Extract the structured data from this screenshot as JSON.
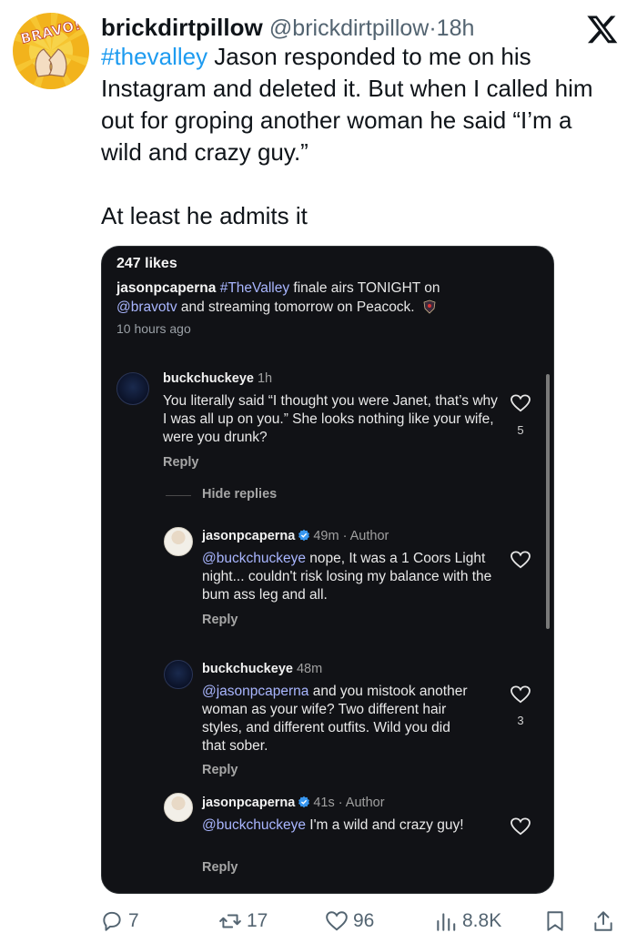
{
  "tweet": {
    "avatar_logo_text": "BRAVO!",
    "display_name": "brickdirtpillow",
    "handle": "@brickdirtpillow",
    "separator": "·",
    "time": "18h",
    "hashtag": "#thevalley",
    "text_1": " Jason responded to me on his Instagram and deleted it. But when I called him out for groping another woman he said “I’m a wild and crazy guy.”",
    "text_2": "At least he admits it"
  },
  "screenshot": {
    "likes": "247 likes",
    "caption_user": "jasonpcaperna",
    "caption_hashtag": "#TheValley",
    "caption_text_1": " finale airs TONIGHT on",
    "caption_mention": "@bravotv",
    "caption_text_2": " and streaming tomorrow on Peacock.",
    "caption_time": "10 hours ago",
    "hide_replies": "Hide replies",
    "comments": [
      {
        "user": "buckchuckeye",
        "meta": " 1h",
        "text": "You literally said “I thought you were Janet, that’s why I was all up on you.” She looks nothing like your wife, were you drunk?",
        "reply": "Reply",
        "likes": "5"
      },
      {
        "user": "jasonpcaperna",
        "meta": "49m · Author",
        "mention": "@buckchuckeye",
        "text": " nope, It was a 1 Coors Light night... couldn't risk losing my balance with the bum ass leg and all.",
        "reply": "Reply",
        "likes": ""
      },
      {
        "user": "buckchuckeye",
        "meta": " 48m",
        "mention": "@jasonpcaperna",
        "text": " and you mistook another woman as your wife? Two different hair styles, and different outfits. Wild you did that sober.",
        "reply": "Reply",
        "likes": "3"
      },
      {
        "user": "jasonpcaperna",
        "meta": "41s · Author",
        "mention": "@buckchuckeye",
        "text": " I'm a wild and crazy guy!",
        "reply": "Reply",
        "likes": ""
      }
    ]
  },
  "actions": {
    "replies": "7",
    "reposts": "17",
    "likes": "96",
    "views": "8.8K"
  },
  "colors": {
    "link_blue": "#1d9bf0",
    "card_bg": "#111216",
    "mention": "#a9b6ff",
    "muted": "#536471"
  },
  "icons": [
    "x-logo-icon",
    "verified-badge-icon",
    "heart-icon",
    "reply-icon",
    "repost-icon",
    "like-icon",
    "views-icon",
    "bookmark-icon",
    "share-icon"
  ]
}
